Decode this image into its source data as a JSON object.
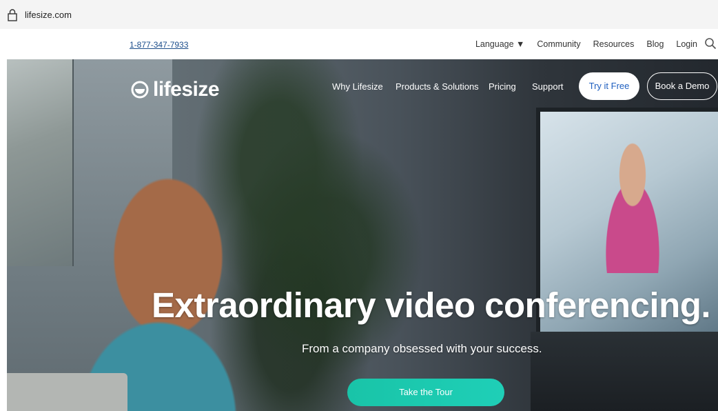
{
  "browser": {
    "url": "lifesize.com"
  },
  "utility_bar": {
    "phone": "1-877-347-7933",
    "links": [
      "Language ▼",
      "Community",
      "Resources",
      "Blog",
      "Login"
    ]
  },
  "header": {
    "logo_text": "lifesize",
    "nav": [
      "Why Lifesize",
      "Products & Solutions",
      "Pricing",
      "Support"
    ],
    "try_free": "Try it Free",
    "book_demo": "Book a Demo"
  },
  "hero": {
    "headline": "Extraordinary video conferencing.",
    "subhead": "From a company obsessed with your success.",
    "cta": "Take the Tour"
  },
  "colors": {
    "cta_teal": "#1fcfb7",
    "try_free_text": "#2060c0",
    "phone_link": "#1a4c8a"
  },
  "icons": [
    "lock-icon",
    "search-icon",
    "lifesize-logo-mark"
  ]
}
